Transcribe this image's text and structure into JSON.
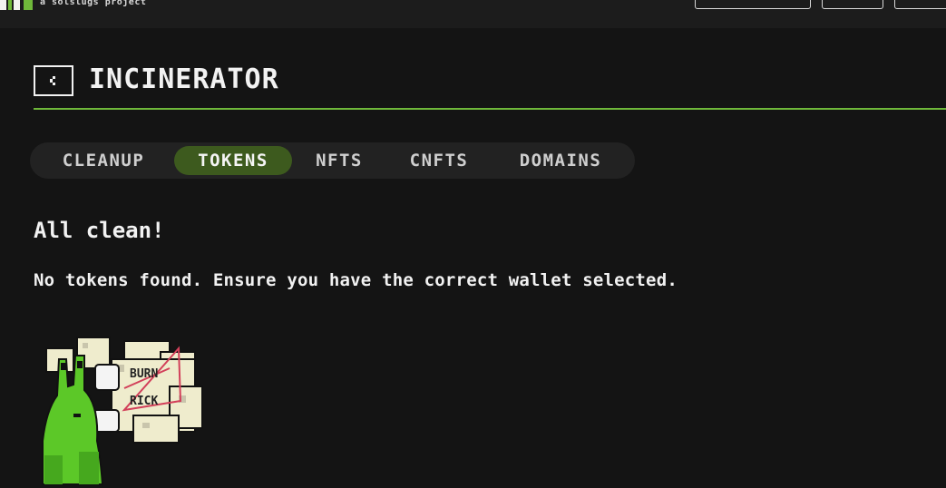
{
  "header": {
    "tagline": "a solslugs project"
  },
  "page": {
    "title": "INCINERATOR",
    "back_icon": "chevron-left-icon"
  },
  "tabs": [
    {
      "label": "CLEANUP",
      "active": false
    },
    {
      "label": "TOKENS",
      "active": true
    },
    {
      "label": "NFTS",
      "active": false
    },
    {
      "label": "CNFTS",
      "active": false
    },
    {
      "label": "DOMAINS",
      "active": false
    }
  ],
  "empty_state": {
    "heading": "All clean!",
    "message": "No tokens found. Ensure you have the correct wallet selected.",
    "illustration": "slug-burn-rick-mascot"
  },
  "colors": {
    "background": "#141414",
    "accent_green": "#6fb83a",
    "active_tab": "#3d5a1e",
    "tab_bar": "#222222"
  }
}
